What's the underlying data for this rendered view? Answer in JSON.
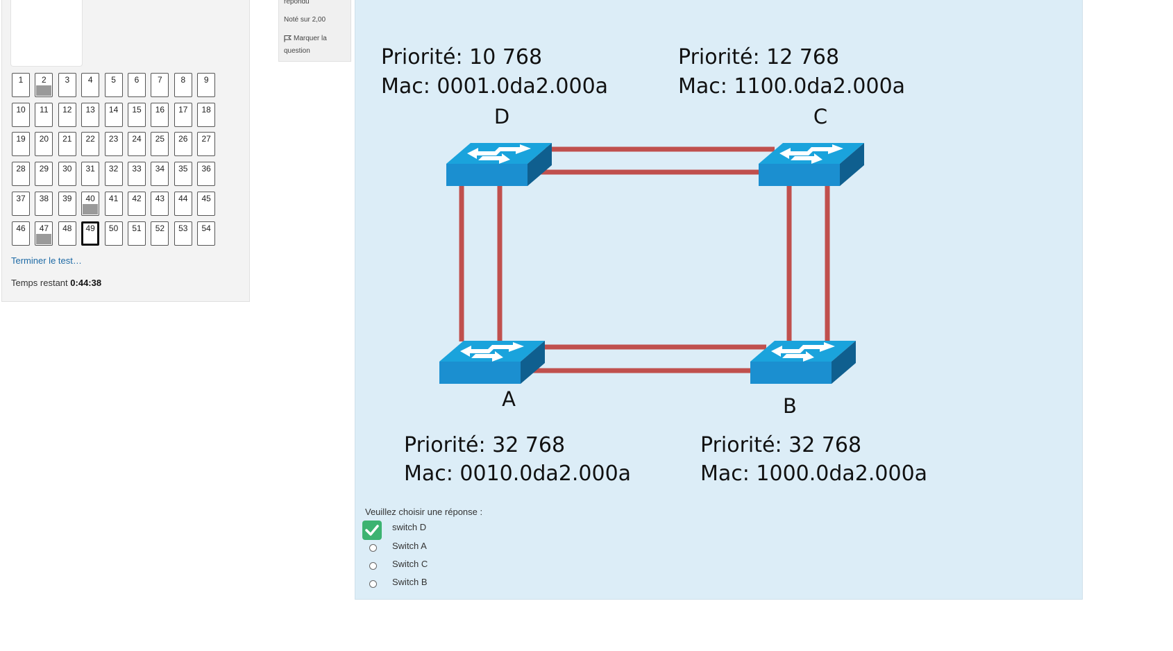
{
  "navigation": {
    "questions": [
      {
        "n": "1",
        "state": "unanswered"
      },
      {
        "n": "2",
        "state": "answered"
      },
      {
        "n": "3",
        "state": "unanswered"
      },
      {
        "n": "4",
        "state": "unanswered"
      },
      {
        "n": "5",
        "state": "unanswered"
      },
      {
        "n": "6",
        "state": "unanswered"
      },
      {
        "n": "7",
        "state": "unanswered"
      },
      {
        "n": "8",
        "state": "unanswered"
      },
      {
        "n": "9",
        "state": "unanswered"
      },
      {
        "n": "10",
        "state": "unanswered"
      },
      {
        "n": "11",
        "state": "unanswered"
      },
      {
        "n": "12",
        "state": "unanswered"
      },
      {
        "n": "13",
        "state": "unanswered"
      },
      {
        "n": "14",
        "state": "unanswered"
      },
      {
        "n": "15",
        "state": "unanswered"
      },
      {
        "n": "16",
        "state": "unanswered"
      },
      {
        "n": "17",
        "state": "unanswered"
      },
      {
        "n": "18",
        "state": "unanswered"
      },
      {
        "n": "19",
        "state": "unanswered"
      },
      {
        "n": "20",
        "state": "unanswered"
      },
      {
        "n": "21",
        "state": "unanswered"
      },
      {
        "n": "22",
        "state": "unanswered"
      },
      {
        "n": "23",
        "state": "unanswered"
      },
      {
        "n": "24",
        "state": "unanswered"
      },
      {
        "n": "25",
        "state": "unanswered"
      },
      {
        "n": "26",
        "state": "unanswered"
      },
      {
        "n": "27",
        "state": "unanswered"
      },
      {
        "n": "28",
        "state": "unanswered"
      },
      {
        "n": "29",
        "state": "unanswered"
      },
      {
        "n": "30",
        "state": "unanswered"
      },
      {
        "n": "31",
        "state": "unanswered"
      },
      {
        "n": "32",
        "state": "unanswered"
      },
      {
        "n": "33",
        "state": "unanswered"
      },
      {
        "n": "34",
        "state": "unanswered"
      },
      {
        "n": "35",
        "state": "unanswered"
      },
      {
        "n": "36",
        "state": "unanswered"
      },
      {
        "n": "37",
        "state": "unanswered"
      },
      {
        "n": "38",
        "state": "unanswered"
      },
      {
        "n": "39",
        "state": "unanswered"
      },
      {
        "n": "40",
        "state": "answered"
      },
      {
        "n": "41",
        "state": "unanswered"
      },
      {
        "n": "42",
        "state": "unanswered"
      },
      {
        "n": "43",
        "state": "unanswered"
      },
      {
        "n": "44",
        "state": "unanswered"
      },
      {
        "n": "45",
        "state": "unanswered"
      },
      {
        "n": "46",
        "state": "unanswered"
      },
      {
        "n": "47",
        "state": "answered"
      },
      {
        "n": "48",
        "state": "unanswered"
      },
      {
        "n": "49",
        "state": "current"
      },
      {
        "n": "50",
        "state": "unanswered"
      },
      {
        "n": "51",
        "state": "unanswered"
      },
      {
        "n": "52",
        "state": "unanswered"
      },
      {
        "n": "53",
        "state": "unanswered"
      },
      {
        "n": "54",
        "state": "unanswered"
      }
    ],
    "finish_link": "Terminer le test…",
    "timer_label": "Temps restant",
    "timer_value": "0:44:38"
  },
  "question_info": {
    "state": "répondu",
    "grade": "Noté sur 2,00",
    "flag_label": "Marquer la question",
    "flag_icon": "flag-icon"
  },
  "diagram": {
    "switches": [
      {
        "id": "D",
        "letter": "D",
        "priority": "Priorité: 10 768",
        "mac": "Mac: 0001.0da2.000a"
      },
      {
        "id": "C",
        "letter": "C",
        "priority": "Priorité: 12 768",
        "mac": "Mac: 1100.0da2.000a"
      },
      {
        "id": "A",
        "letter": "A",
        "priority": "Priorité: 32 768",
        "mac": "Mac: 0010.0da2.000a"
      },
      {
        "id": "B",
        "letter": "B",
        "priority": "Priorité: 32 768",
        "mac": "Mac: 1000.0da2.000a"
      }
    ],
    "colors": {
      "switch_top": "#1aa3dc",
      "switch_front": "#1b8fd0",
      "switch_side": "#0f5f8f",
      "link": "#c0504d",
      "arrow": "#ffffff"
    }
  },
  "question": {
    "prompt": "Veuillez choisir une réponse :",
    "answers": [
      {
        "label": "switch D",
        "selected": true
      },
      {
        "label": "Switch A",
        "selected": false
      },
      {
        "label": "Switch C",
        "selected": false
      },
      {
        "label": "Switch B",
        "selected": false
      }
    ],
    "check_color": "#3cb371"
  }
}
